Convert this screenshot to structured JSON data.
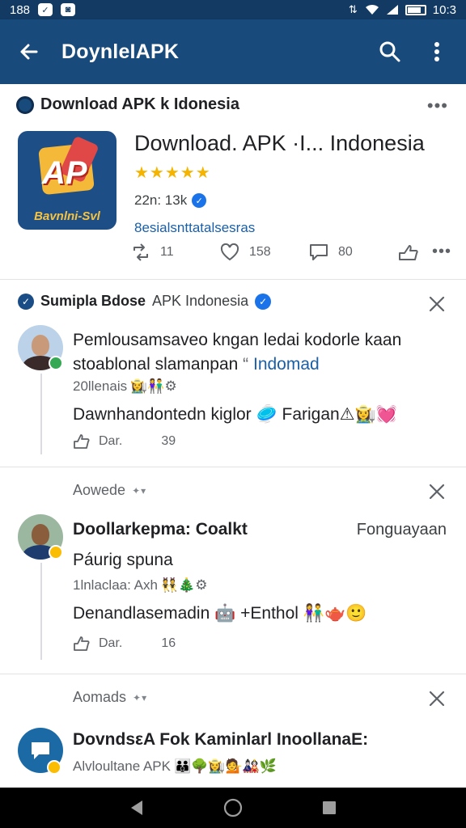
{
  "status_bar": {
    "time_left": "188",
    "time_right": "10:3",
    "icons": [
      "shield-icon",
      "lock-icon",
      "data-icon",
      "wifi-icon",
      "signal-icon",
      "battery-icon"
    ]
  },
  "app_bar": {
    "title": "DoynleIAPK",
    "icons": [
      "back-arrow-icon",
      "search-icon",
      "overflow-menu-icon"
    ],
    "color": "#184a7c"
  },
  "page_card": {
    "page_name": "Download APK k Idonesia",
    "app_icon_letters": "AP",
    "app_icon_caption": "Bavnlni-Svl",
    "app_name": "Download. APK ·I... Indonesia",
    "stars": "★★★★★",
    "meta": "22n: 13k",
    "link": "8esialsnttatalsesras",
    "actions": [
      {
        "icon": "retweet-icon",
        "count": "11"
      },
      {
        "icon": "heart-icon",
        "count": "158"
      },
      {
        "icon": "comment-icon",
        "count": "80"
      },
      {
        "icon": "share-icon",
        "count": ""
      }
    ]
  },
  "comments": [
    {
      "header_name": "Sumipla Bdose",
      "header_sub": "APK Indonesia",
      "text_line1": "Pemlousamsaveo kngan ledai kodorle kaan",
      "text_line2": "stoablonal slamanpan",
      "text_link": "Indomad",
      "meta": "20llenais",
      "meta_emoji": "👩‍🌾👫⚙",
      "text2": "Dawnhandontedn kiglor",
      "text2_tail": "Farigan",
      "text2_emoji_mid": "🥏",
      "text2_emoji_end": "⚠👩‍🌾💓",
      "reply_label": "Dar.",
      "reply_count": "39"
    },
    {
      "section_label": "Aowede",
      "name": "Doollarkepma: Coalkt",
      "side_tag": "Fonguayaan",
      "text1": "Páurig spuna",
      "meta": "1lnlaclaa: Axh",
      "meta_emoji": "👯🎄⚙",
      "text2": "Denandlasemadin",
      "text2_mid": "+Enthol",
      "text2_emoji_a": "🤖",
      "text2_emoji_b": "👫🫖🙂",
      "reply_label": "Dar.",
      "reply_count": "16"
    },
    {
      "section_label": "Aomads",
      "name": "DovndsεA Fok Kaminlarl InoollanaE:",
      "meta": "Alvloultane APK",
      "meta_emoji": "👪🌳👩‍🌾💁🎎🌿"
    }
  ],
  "nav_bar": {
    "icons": [
      "nav-back-icon",
      "nav-home-icon",
      "nav-recents-icon"
    ]
  }
}
